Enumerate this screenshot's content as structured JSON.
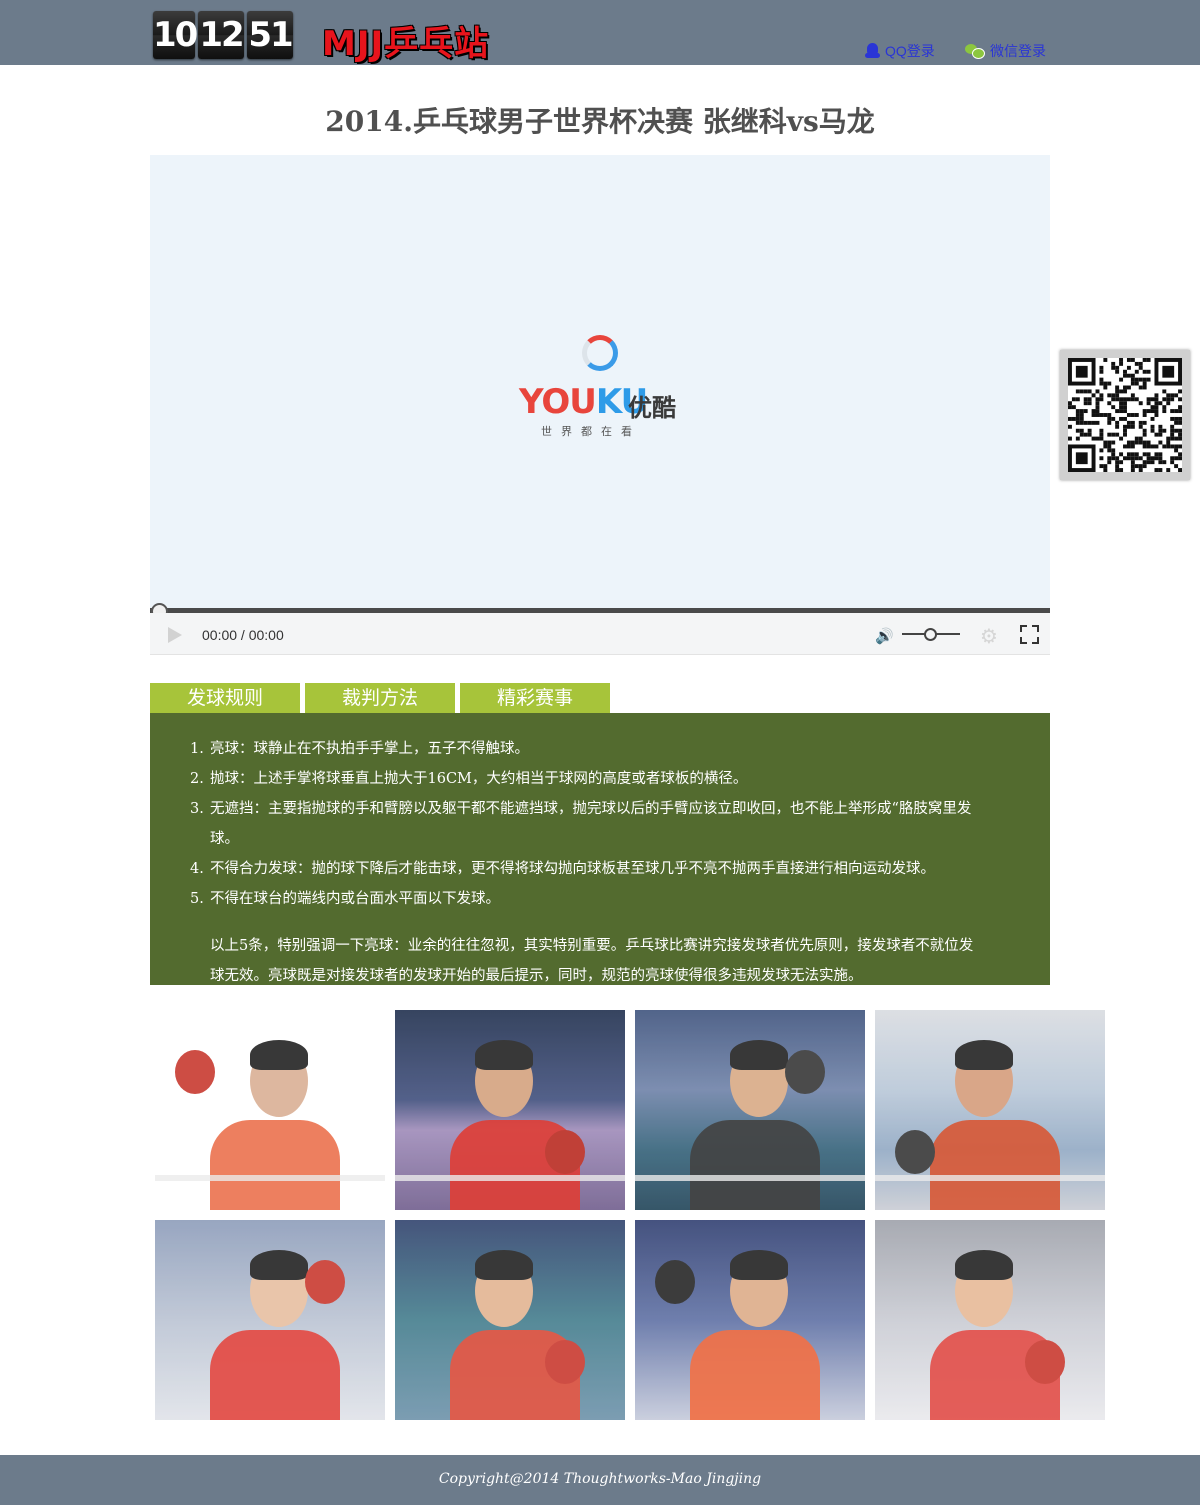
{
  "header": {
    "clock": [
      "10",
      "12",
      "51"
    ],
    "site_title": "MJJ乒乓站",
    "qq_login": "QQ登录",
    "wechat_login": "微信登录"
  },
  "page_title": "2014.乒乓球男子世界杯决赛 张继科vs马龙",
  "video": {
    "brand": "YOUKU",
    "brand_cn": "优酷",
    "slogan": "世界都在看",
    "time": "00:00 / 00:00"
  },
  "tabs": [
    "发球规则",
    "裁判方法",
    "精彩赛事"
  ],
  "rules": [
    "亮球：球静止在不执拍手手掌上，五子不得触球。",
    "抛球：上述手掌将球垂直上抛大于16CM，大约相当于球网的高度或者球板的横径。",
    "无遮挡：主要指抛球的手和臂膀以及躯干都不能遮挡球，抛完球以后的手臂应该立即收回，也不能上举形成“胳肢窝里发",
    "球。",
    "不得合力发球：抛的球下降后才能击球，更不得将球勾抛向球板甚至球几乎不亮不抛两手直接进行相向运动发球。",
    "不得在球台的端线内或台面水平面以下发球。"
  ],
  "rule_numbers": [
    "1.",
    "2.",
    "3.",
    "4.",
    "5."
  ],
  "note_line1": "以上5条，特别强调一下亮球：业余的往往忽视，其实特别重要。乒乓球比赛讲究接发球者优先原则，接发球者不就位发",
  "note_line2": "球无效。亮球既是对接发球者的发球开始的最后提示，同时，规范的亮球使得很多违规发球无法实施。",
  "colors": {
    "header_bg": "#6c7b8b",
    "tab_bg": "#a7c43a",
    "panel_bg": "#536b2f",
    "link": "#2a35d6"
  },
  "footer": "Copyright@2014 Thoughtworks-Mao Jingjing"
}
